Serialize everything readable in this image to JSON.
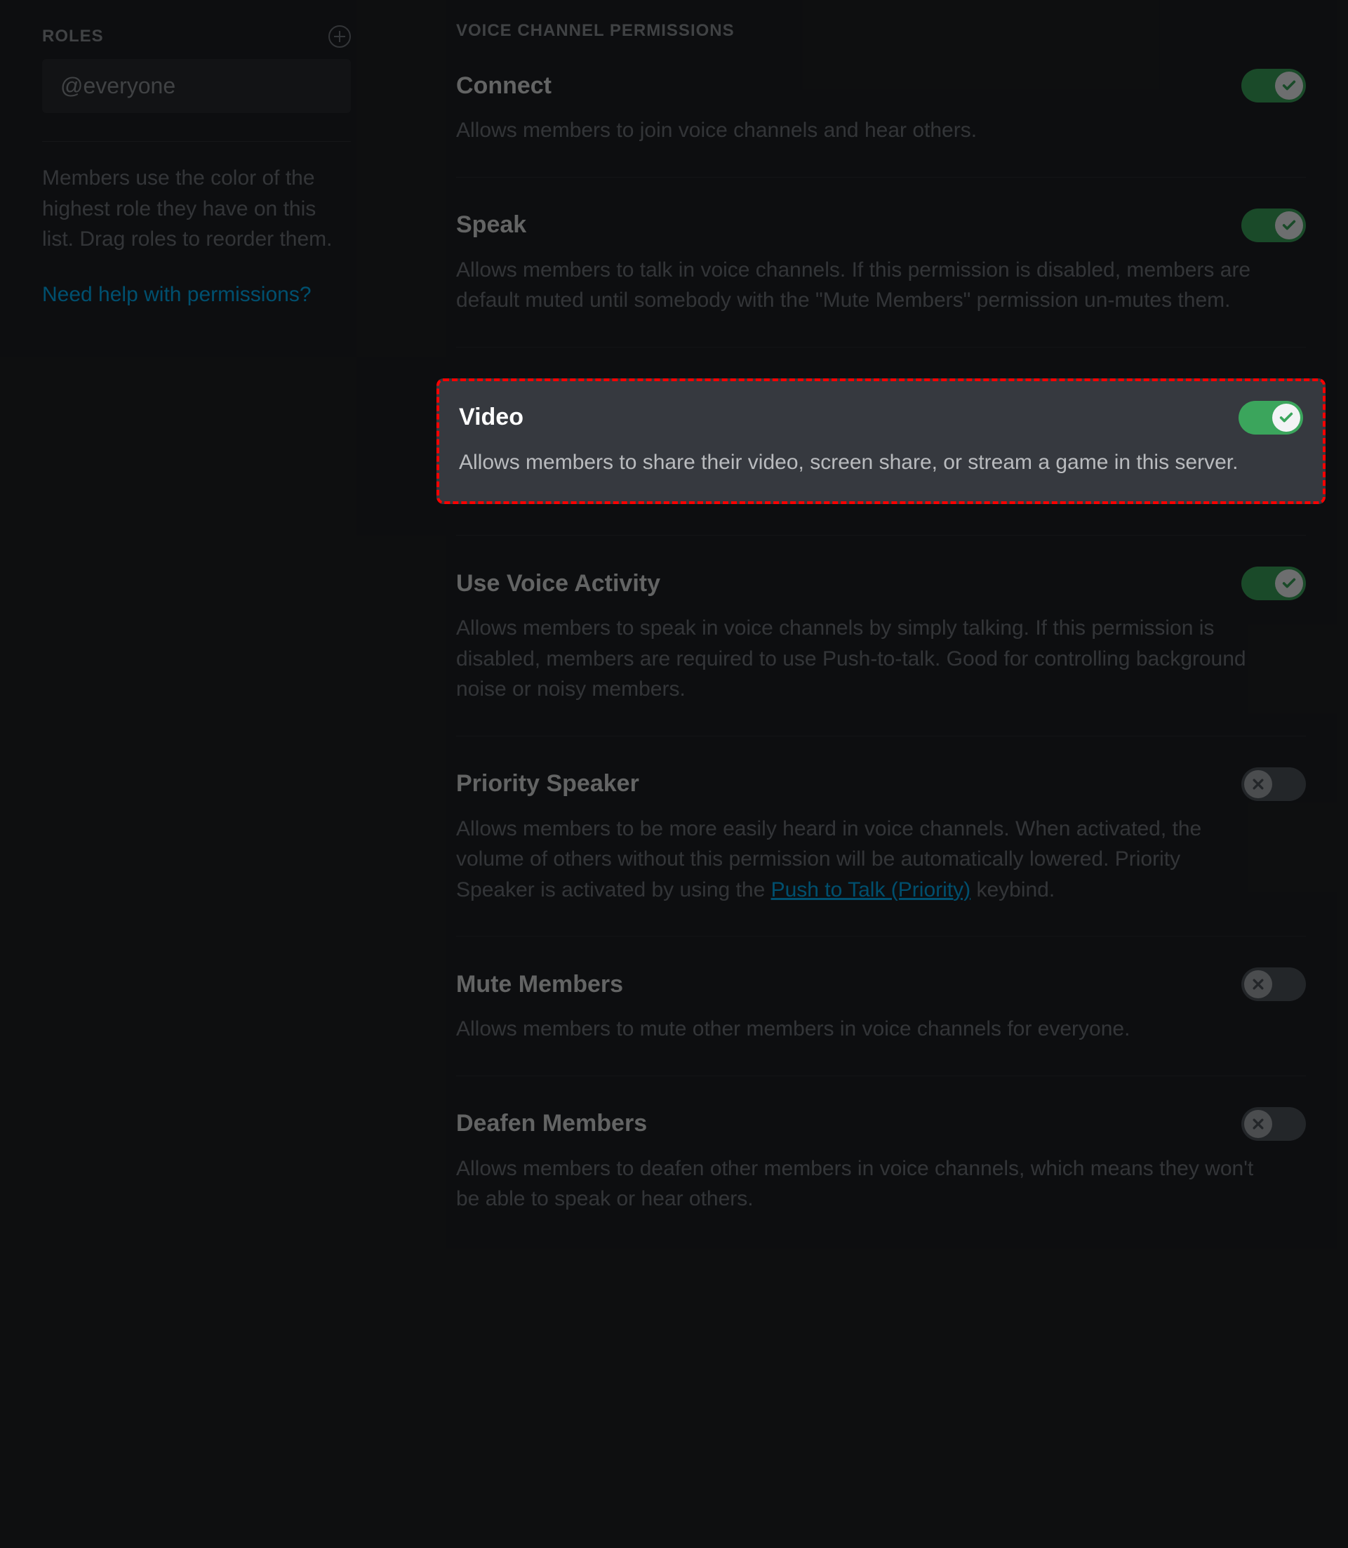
{
  "sidebar": {
    "header": "ROLES",
    "role_label": "@everyone",
    "description": "Members use the color of the highest role they have on this list. Drag roles to reorder them.",
    "help_link": "Need help with permissions?"
  },
  "section_header": "VOICE CHANNEL PERMISSIONS",
  "permissions": {
    "connect": {
      "title": "Connect",
      "desc": "Allows members to join voice channels and hear others.",
      "enabled": true
    },
    "speak": {
      "title": "Speak",
      "desc": "Allows members to talk in voice channels. If this permission is disabled, members are default muted until somebody with the \"Mute Members\" permission un-mutes them.",
      "enabled": true
    },
    "video": {
      "title": "Video",
      "desc": "Allows members to share their video, screen share, or stream a game in this server.",
      "enabled": true
    },
    "voice_activity": {
      "title": "Use Voice Activity",
      "desc": "Allows members to speak in voice channels by simply talking. If this permission is disabled, members are required to use Push-to-talk. Good for controlling background noise or noisy members.",
      "enabled": true
    },
    "priority_speaker": {
      "title": "Priority Speaker",
      "desc_before": "Allows members to be more easily heard in voice channels. When activated, the volume of others without this permission will be automatically lowered. Priority Speaker is activated by using the ",
      "desc_link": "Push to Talk (Priority)",
      "desc_after": " keybind.",
      "enabled": false
    },
    "mute_members": {
      "title": "Mute Members",
      "desc": "Allows members to mute other members in voice channels for everyone.",
      "enabled": false
    },
    "deafen_members": {
      "title": "Deafen Members",
      "desc": "Allows members to deafen other members in voice channels, which means they won't be able to speak or hear others.",
      "enabled": false
    }
  }
}
